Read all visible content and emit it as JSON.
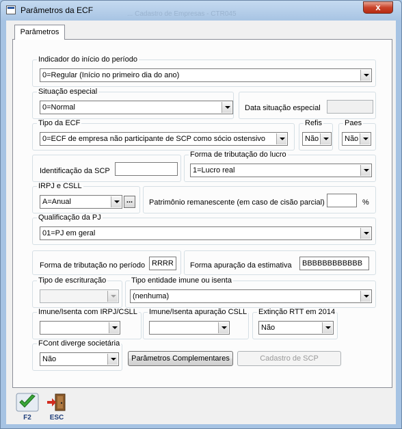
{
  "window": {
    "title": "Parâmetros da ECF",
    "ghost_title": "... Cadastro de Empresas - CTR045",
    "close_label": "x"
  },
  "tabs": [
    {
      "label": "Parâmetros"
    }
  ],
  "fields": {
    "indicador": {
      "label": "Indicador do início do período",
      "value": "0=Regular (Início no primeiro dia do ano)"
    },
    "situacao": {
      "label": "Situação especial",
      "value": "0=Normal"
    },
    "data_situacao": {
      "label": "Data situação especial",
      "value": ""
    },
    "tipo_ecf": {
      "label": "Tipo da ECF",
      "value": "0=ECF de empresa não participante de SCP como sócio ostensivo"
    },
    "refis": {
      "label": "Refis",
      "value": "Não"
    },
    "paes": {
      "label": "Paes",
      "value": "Não"
    },
    "identificacao_scp": {
      "label": "Identificação da SCP",
      "value": ""
    },
    "forma_tributacao_lucro": {
      "label": "Forma de tributação do lucro",
      "value": "1=Lucro real"
    },
    "irpj_csll": {
      "label": "IRPJ e CSLL",
      "value": "A=Anual",
      "button": "..."
    },
    "patrimonio": {
      "label": "Patrimônio remanescente (em caso de cisão parcial)",
      "value": "",
      "unit": "%"
    },
    "qualificacao": {
      "label": "Qualificação da PJ",
      "value": "01=PJ em geral"
    },
    "forma_tributacao_periodo": {
      "label": "Forma de tributação no período",
      "value": "RRRR"
    },
    "forma_apuracao_estimativa": {
      "label": "Forma apuração da estimativa",
      "value": "BBBBBBBBBBBB"
    },
    "tipo_escrituracao": {
      "label": "Tipo de escrituração",
      "value": ""
    },
    "tipo_entidade": {
      "label": "Tipo entidade imune ou isenta",
      "value": "(nenhuma)"
    },
    "imune_irpj": {
      "label": "Imune/Isenta com IRPJ/CSLL",
      "value": ""
    },
    "imune_csll": {
      "label": "Imune/Isenta apuração CSLL",
      "value": ""
    },
    "extincao_rtt": {
      "label": "Extinção RTT em 2014",
      "value": "Não"
    },
    "fcont": {
      "label": "FCont diverge societária",
      "value": "Não"
    }
  },
  "buttons": {
    "parametros_complementares": "Parâmetros Complementares",
    "cadastro_scp": "Cadastro de SCP"
  },
  "footer": {
    "confirm": {
      "key": "F2",
      "icon": "checkmark-icon"
    },
    "exit": {
      "key": "ESC",
      "icon": "exit-door-icon"
    }
  },
  "colors": {
    "frame": "#a6c3e3",
    "close_red": "#c9432a",
    "panel": "#fcfcfc",
    "check_green": "#3aa63a"
  }
}
